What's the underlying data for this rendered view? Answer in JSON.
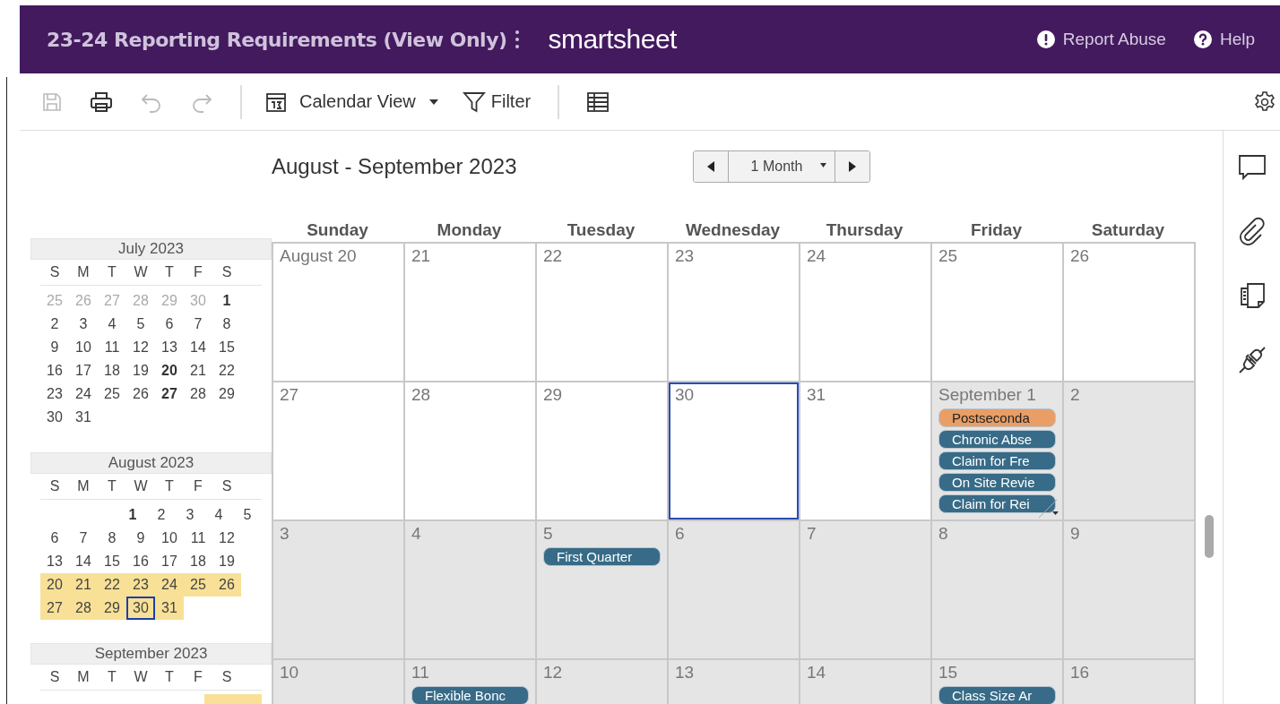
{
  "header": {
    "title": "23-24 Reporting Requirements (View Only)",
    "brand": "smartsheet",
    "links": [
      {
        "kind": "report",
        "label": "Report Abuse"
      },
      {
        "kind": "help",
        "label": "Help"
      }
    ]
  },
  "toolbar": {
    "view_label": "Calendar View",
    "filter_label": "Filter"
  },
  "mini_calendars": [
    {
      "title": "July 2023",
      "weekdays": [
        "S",
        "M",
        "T",
        "W",
        "T",
        "F",
        "S"
      ],
      "weeks": [
        {
          "highlighted": false,
          "days": [
            {
              "label": "25",
              "kind": "muted",
              "selected": false
            },
            {
              "label": "26",
              "kind": "muted",
              "selected": false
            },
            {
              "label": "27",
              "kind": "muted",
              "selected": false
            },
            {
              "label": "28",
              "kind": "muted",
              "selected": false
            },
            {
              "label": "29",
              "kind": "muted",
              "selected": false
            },
            {
              "label": "30",
              "kind": "muted",
              "selected": false
            },
            {
              "label": "1",
              "kind": "bold",
              "selected": false
            }
          ]
        },
        {
          "highlighted": false,
          "days": [
            {
              "label": "2",
              "kind": "plain",
              "selected": false
            },
            {
              "label": "3",
              "kind": "plain",
              "selected": false
            },
            {
              "label": "4",
              "kind": "plain",
              "selected": false
            },
            {
              "label": "5",
              "kind": "plain",
              "selected": false
            },
            {
              "label": "6",
              "kind": "plain",
              "selected": false
            },
            {
              "label": "7",
              "kind": "plain",
              "selected": false
            },
            {
              "label": "8",
              "kind": "plain",
              "selected": false
            }
          ]
        },
        {
          "highlighted": false,
          "days": [
            {
              "label": "9",
              "kind": "plain",
              "selected": false
            },
            {
              "label": "10",
              "kind": "plain",
              "selected": false
            },
            {
              "label": "11",
              "kind": "plain",
              "selected": false
            },
            {
              "label": "12",
              "kind": "plain",
              "selected": false
            },
            {
              "label": "13",
              "kind": "plain",
              "selected": false
            },
            {
              "label": "14",
              "kind": "plain",
              "selected": false
            },
            {
              "label": "15",
              "kind": "plain",
              "selected": false
            }
          ]
        },
        {
          "highlighted": false,
          "days": [
            {
              "label": "16",
              "kind": "plain",
              "selected": false
            },
            {
              "label": "17",
              "kind": "plain",
              "selected": false
            },
            {
              "label": "18",
              "kind": "plain",
              "selected": false
            },
            {
              "label": "19",
              "kind": "plain",
              "selected": false
            },
            {
              "label": "20",
              "kind": "bold",
              "selected": false
            },
            {
              "label": "21",
              "kind": "plain",
              "selected": false
            },
            {
              "label": "22",
              "kind": "plain",
              "selected": false
            }
          ]
        },
        {
          "highlighted": false,
          "days": [
            {
              "label": "23",
              "kind": "plain",
              "selected": false
            },
            {
              "label": "24",
              "kind": "plain",
              "selected": false
            },
            {
              "label": "25",
              "kind": "plain",
              "selected": false
            },
            {
              "label": "26",
              "kind": "plain",
              "selected": false
            },
            {
              "label": "27",
              "kind": "bold",
              "selected": false
            },
            {
              "label": "28",
              "kind": "plain",
              "selected": false
            },
            {
              "label": "29",
              "kind": "plain",
              "selected": false
            }
          ]
        },
        {
          "highlighted": false,
          "days": [
            {
              "label": "30",
              "kind": "plain",
              "selected": false
            },
            {
              "label": "31",
              "kind": "plain",
              "selected": false
            }
          ]
        }
      ]
    },
    {
      "title": "August 2023",
      "weekdays": [
        "S",
        "M",
        "T",
        "W",
        "T",
        "F",
        "S"
      ],
      "weeks": [
        {
          "highlighted": false,
          "days": [
            {
              "label": "1",
              "kind": "bold",
              "selected": false
            },
            {
              "label": "2",
              "kind": "plain",
              "selected": false
            },
            {
              "label": "3",
              "kind": "plain",
              "selected": false
            },
            {
              "label": "4",
              "kind": "plain",
              "selected": false
            },
            {
              "label": "5",
              "kind": "plain",
              "selected": false
            }
          ]
        },
        {
          "highlighted": false,
          "days": [
            {
              "label": "6",
              "kind": "plain",
              "selected": false
            },
            {
              "label": "7",
              "kind": "plain",
              "selected": false
            },
            {
              "label": "8",
              "kind": "plain",
              "selected": false
            },
            {
              "label": "9",
              "kind": "plain",
              "selected": false
            },
            {
              "label": "10",
              "kind": "plain",
              "selected": false
            },
            {
              "label": "11",
              "kind": "plain",
              "selected": false
            },
            {
              "label": "12",
              "kind": "plain",
              "selected": false
            }
          ]
        },
        {
          "highlighted": false,
          "days": [
            {
              "label": "13",
              "kind": "plain",
              "selected": false
            },
            {
              "label": "14",
              "kind": "plain",
              "selected": false
            },
            {
              "label": "15",
              "kind": "plain",
              "selected": false
            },
            {
              "label": "16",
              "kind": "plain",
              "selected": false
            },
            {
              "label": "17",
              "kind": "plain",
              "selected": false
            },
            {
              "label": "18",
              "kind": "plain",
              "selected": false
            },
            {
              "label": "19",
              "kind": "plain",
              "selected": false
            }
          ]
        },
        {
          "highlighted": true,
          "days": [
            {
              "label": "20",
              "kind": "plain",
              "selected": false
            },
            {
              "label": "21",
              "kind": "plain",
              "selected": false
            },
            {
              "label": "22",
              "kind": "plain",
              "selected": false
            },
            {
              "label": "23",
              "kind": "plain",
              "selected": false
            },
            {
              "label": "24",
              "kind": "plain",
              "selected": false
            },
            {
              "label": "25",
              "kind": "plain",
              "selected": false
            },
            {
              "label": "26",
              "kind": "plain",
              "selected": false
            }
          ]
        },
        {
          "highlighted": true,
          "days": [
            {
              "label": "27",
              "kind": "plain",
              "selected": false
            },
            {
              "label": "28",
              "kind": "plain",
              "selected": false
            },
            {
              "label": "29",
              "kind": "plain",
              "selected": false
            },
            {
              "label": "30",
              "kind": "plain",
              "selected": true
            },
            {
              "label": "31",
              "kind": "plain",
              "selected": false
            }
          ]
        }
      ]
    },
    {
      "title": "September 2023",
      "weekdays": [
        "S",
        "M",
        "T",
        "W",
        "T",
        "F",
        "S"
      ],
      "weeks": [
        {
          "highlighted": true
        }
      ]
    }
  ],
  "calendar": {
    "title": "August - September 2023",
    "period": "1 Month",
    "weekdays": [
      "Sunday",
      "Monday",
      "Tuesday",
      "Wednesday",
      "Thursday",
      "Friday",
      "Saturday"
    ],
    "weeks": [
      [
        {
          "label": "August 20",
          "other_month": false,
          "selected": false
        },
        {
          "label": "21",
          "other_month": false,
          "selected": false
        },
        {
          "label": "22",
          "other_month": false,
          "selected": false
        },
        {
          "label": "23",
          "other_month": false,
          "selected": false
        },
        {
          "label": "24",
          "other_month": false,
          "selected": false
        },
        {
          "label": "25",
          "other_month": false,
          "selected": false
        },
        {
          "label": "26",
          "other_month": false,
          "selected": false
        }
      ],
      [
        {
          "label": "27",
          "other_month": false,
          "selected": false
        },
        {
          "label": "28",
          "other_month": false,
          "selected": false
        },
        {
          "label": "29",
          "other_month": false,
          "selected": false
        },
        {
          "label": "30",
          "other_month": false,
          "selected": true
        },
        {
          "label": "31",
          "other_month": false,
          "selected": false
        },
        {
          "label": "September 1",
          "other_month": true,
          "selected": false,
          "events": [
            {
              "label": "Postseconda",
              "color": "#e99e66"
            },
            {
              "label": "Chronic Abse",
              "color": "#376b87"
            },
            {
              "label": "Claim for Fre",
              "color": "#376b87"
            },
            {
              "label": "On Site Revie",
              "color": "#376b87"
            },
            {
              "label": "Claim for Rei",
              "color": "#376b87"
            }
          ]
        },
        {
          "label": "2",
          "other_month": true,
          "selected": false
        }
      ],
      [
        {
          "label": "3",
          "other_month": true,
          "selected": false
        },
        {
          "label": "4",
          "other_month": true,
          "selected": false
        },
        {
          "label": "5",
          "other_month": true,
          "selected": false,
          "events": [
            {
              "label": "First Quarter",
              "color": "#376b87"
            }
          ]
        },
        {
          "label": "6",
          "other_month": true,
          "selected": false
        },
        {
          "label": "7",
          "other_month": true,
          "selected": false
        },
        {
          "label": "8",
          "other_month": true,
          "selected": false
        },
        {
          "label": "9",
          "other_month": true,
          "selected": false
        }
      ],
      [
        {
          "label": "10",
          "other_month": true,
          "selected": false
        },
        {
          "label": "11",
          "other_month": true,
          "selected": false,
          "events": [
            {
              "label": "Flexible Bonc",
              "color": "#376b87"
            }
          ]
        },
        {
          "label": "12",
          "other_month": true,
          "selected": false
        },
        {
          "label": "13",
          "other_month": true,
          "selected": false
        },
        {
          "label": "14",
          "other_month": true,
          "selected": false
        },
        {
          "label": "15",
          "other_month": true,
          "selected": false,
          "events": [
            {
              "label": "Class Size Ar",
              "color": "#376b87"
            }
          ]
        },
        {
          "label": "16",
          "other_month": true,
          "selected": false
        }
      ]
    ]
  }
}
